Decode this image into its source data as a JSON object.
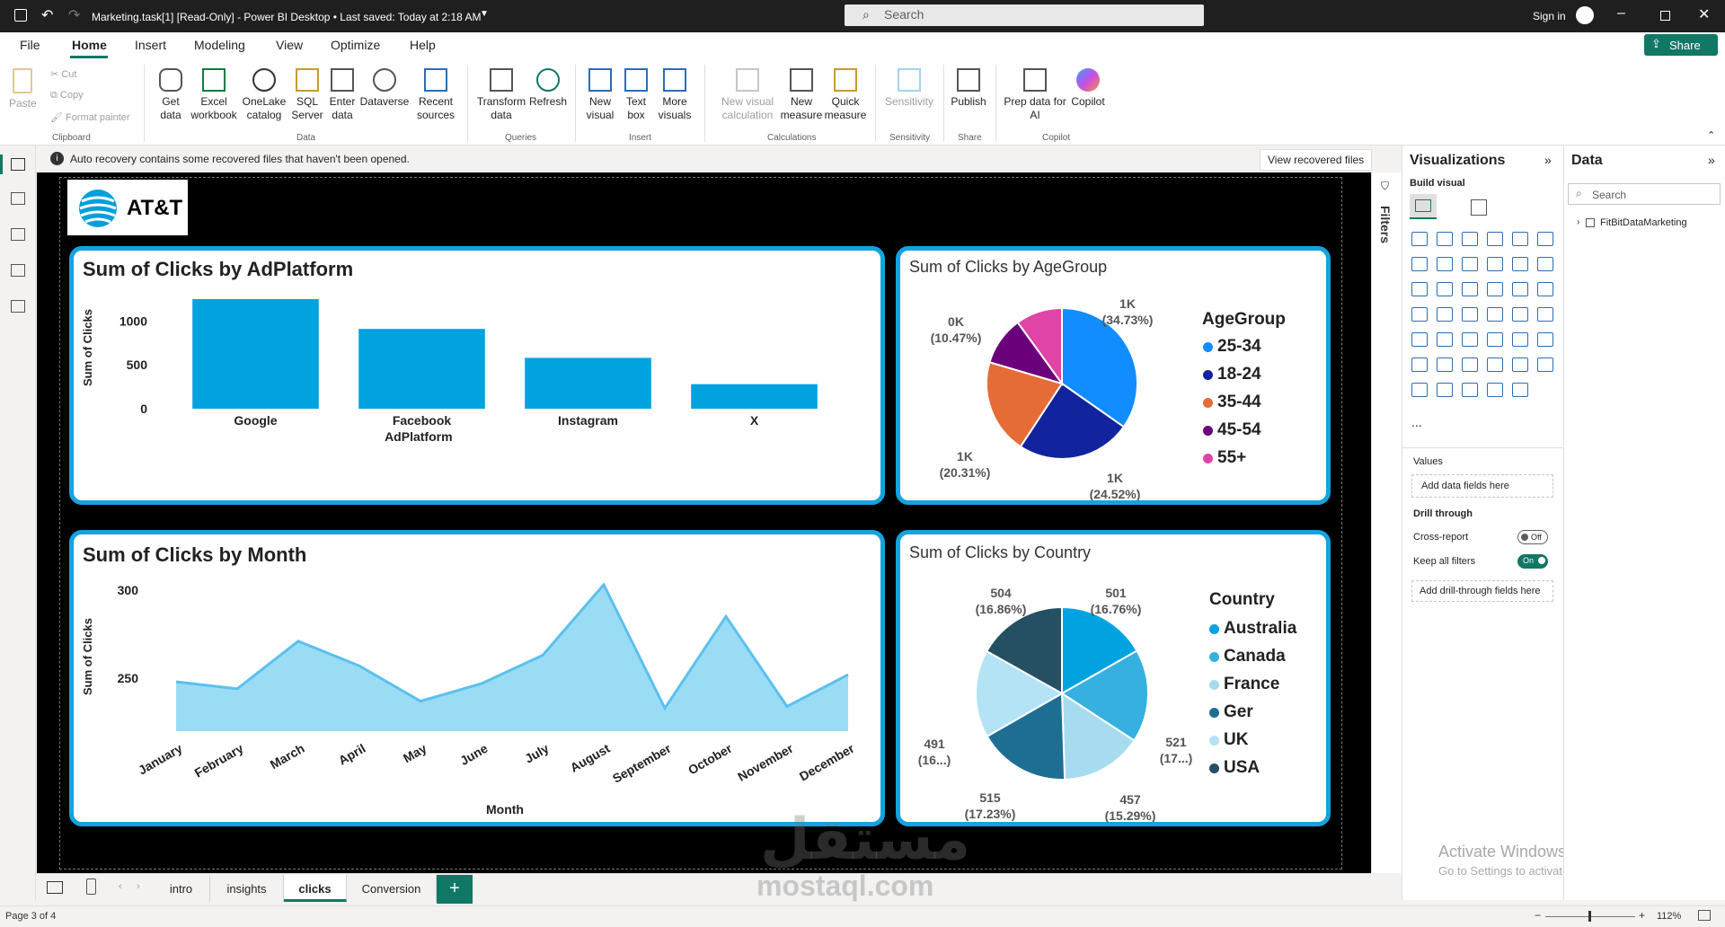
{
  "window": {
    "title": "Marketing.task[1] [Read-Only] - Power BI Desktop • Last saved: Today at 2:18 AM",
    "search_placeholder": "Search",
    "signin": "Sign in",
    "share": "Share"
  },
  "menu": [
    "File",
    "Home",
    "Insert",
    "Modeling",
    "View",
    "Optimize",
    "Help"
  ],
  "ribbon": {
    "clipboard": {
      "paste": "Paste",
      "cut": "Cut",
      "copy": "Copy",
      "format_painter": "Format painter",
      "group": "Clipboard"
    },
    "data": {
      "get_data": "Get\ndata",
      "excel": "Excel\nworkbook",
      "onelake": "OneLake\ncatalog",
      "sql": "SQL\nServer",
      "enter": "Enter\ndata",
      "dataverse": "Dataverse",
      "recent": "Recent\nsources",
      "group": "Data"
    },
    "queries": {
      "transform": "Transform\ndata",
      "refresh": "Refresh",
      "group": "Queries"
    },
    "insert": {
      "new_visual": "New\nvisual",
      "text_box": "Text\nbox",
      "more_visuals": "More\nvisuals",
      "group": "Insert"
    },
    "calculations": {
      "new_visual_calc": "New visual\ncalculation",
      "new_measure": "New\nmeasure",
      "quick_measure": "Quick\nmeasure",
      "group": "Calculations"
    },
    "sensitivity": {
      "label": "Sensitivity",
      "group": "Sensitivity"
    },
    "share": {
      "publish": "Publish",
      "group": "Share"
    },
    "copilot": {
      "prep": "Prep data for\nAI",
      "copilot": "Copilot",
      "group": "Copilot"
    }
  },
  "infobar": {
    "message": "Auto recovery contains some recovered files that haven't been opened.",
    "button": "View recovered files"
  },
  "report": {
    "logo_text": "AT&T",
    "platform_chart": {
      "title": "Sum of Clicks by AdPlatform",
      "xlabel": "AdPlatform",
      "ylabel": "Sum of Clicks",
      "yticks": [
        "1000",
        "500",
        "0"
      ]
    },
    "age_chart": {
      "title": "Sum of Clicks by AgeGroup",
      "legend_title": "AgeGroup"
    },
    "month_chart": {
      "title": "Sum of Clicks by Month",
      "xlabel": "Month",
      "ylabel": "Sum of Clicks",
      "yticks": [
        "300",
        "250"
      ]
    },
    "country_chart": {
      "title": "Sum of Clicks by Country",
      "legend_title": "Country"
    }
  },
  "chart_data": [
    {
      "type": "bar",
      "title": "Sum of Clicks by AdPlatform",
      "categories": [
        "Google",
        "Facebook",
        "Instagram",
        "X"
      ],
      "values": [
        1250,
        910,
        580,
        280
      ],
      "xlabel": "AdPlatform",
      "ylabel": "Sum of Clicks",
      "ylim": [
        0,
        1250
      ],
      "color": "#00a2e0"
    },
    {
      "type": "pie",
      "title": "Sum of Clicks by AgeGroup",
      "categories": [
        "25-34",
        "18-24",
        "35-44",
        "45-54",
        "55+"
      ],
      "values": [
        34.73,
        24.52,
        20.31,
        10.47,
        9.97
      ],
      "labels": [
        [
          "1K",
          "(34.73%)"
        ],
        [
          "1K",
          "(24.52%)"
        ],
        [
          "1K",
          "(20.31%)"
        ],
        [
          "0K",
          "(10.47%)"
        ]
      ],
      "colors": [
        "#118dff",
        "#12239e",
        "#e66c37",
        "#6b007b",
        "#e044a7"
      ],
      "legend_title": "AgeGroup"
    },
    {
      "type": "area",
      "title": "Sum of Clicks by Month",
      "categories": [
        "January",
        "February",
        "March",
        "April",
        "May",
        "June",
        "July",
        "August",
        "September",
        "October",
        "November",
        "December"
      ],
      "values": [
        248,
        244,
        271,
        257,
        237,
        247,
        263,
        303,
        233,
        285,
        234,
        252
      ],
      "xlabel": "Month",
      "ylabel": "Sum of Clicks",
      "ylim": [
        220,
        305
      ]
    },
    {
      "type": "pie",
      "title": "Sum of Clicks by Country",
      "categories": [
        "Australia",
        "Canada",
        "France",
        "Ger",
        "UK",
        "USA"
      ],
      "values": [
        501,
        521,
        457,
        515,
        491,
        504
      ],
      "labels": [
        [
          "501",
          "(16.76%)"
        ],
        [
          "521",
          "(17...)"
        ],
        [
          "457",
          "(15.29%)"
        ],
        [
          "515",
          "(17.23%)"
        ],
        [
          "491",
          "(16...)"
        ],
        [
          "504",
          "(16.86%)"
        ]
      ],
      "colors": [
        "#00a3e0",
        "#36b0e0",
        "#a7dcf0",
        "#1e6e94",
        "#b3e3f5",
        "#254f63"
      ],
      "legend_title": "Country"
    }
  ],
  "filters_label": "Filters",
  "viz_pane": {
    "title": "Visualizations",
    "build_visual": "Build visual",
    "values": "Values",
    "add_data": "Add data fields here",
    "drill": "Drill through",
    "cross_report": "Cross-report",
    "cross_state": "Off",
    "keep_filters": "Keep all filters",
    "keep_state": "On",
    "add_drill": "Add drill-through fields here",
    "more": "..."
  },
  "data_pane": {
    "title": "Data",
    "search_placeholder": "Search",
    "table": "FitBitDataMarketing"
  },
  "tabs": [
    "intro",
    "insights",
    "clicks",
    "Conversion"
  ],
  "active_tab": "clicks",
  "status": {
    "page": "Page 3 of 4",
    "zoom": "112%"
  },
  "watermark": {
    "activate": "Activate Windows",
    "goto": "Go to Settings to activate Windows.",
    "brand_ar": "مستقل",
    "brand": "mostaql.com"
  }
}
